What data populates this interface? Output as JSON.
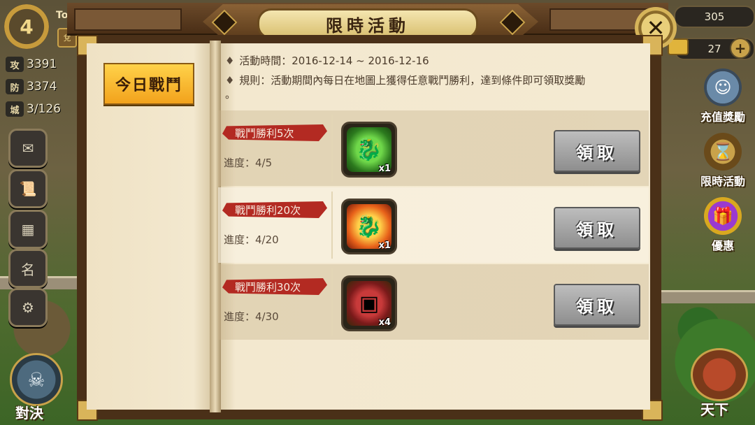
{
  "player": {
    "level": "4",
    "name": "Toto",
    "vip_label": "兌",
    "stats": [
      {
        "icon": "攻",
        "value": "3391"
      },
      {
        "icon": "防",
        "value": "3374"
      },
      {
        "icon": "城",
        "value": "3/126"
      }
    ]
  },
  "left_menu": {
    "items": [
      {
        "name": "mail",
        "glyph": "✉"
      },
      {
        "name": "scroll",
        "glyph": "📜"
      },
      {
        "name": "calendar",
        "glyph": "▦"
      },
      {
        "name": "rank",
        "glyph": "名"
      },
      {
        "name": "settings",
        "glyph": "⚙"
      }
    ],
    "duel_label": "對決"
  },
  "resources": {
    "top_value": "305",
    "gold_value": "27",
    "plus": "+"
  },
  "right_menu": {
    "recharge_label": "充值獎勵",
    "limited_label": "限時活動",
    "discount_label": "優惠",
    "tianxia_label": "天下"
  },
  "dialog": {
    "title": "限時活動",
    "close": "✕",
    "tab_label": "今日戰鬥",
    "time_line": "活動時間：2016-12-14 ~ 2016-12-16",
    "rule_line": "規則：活動期間內每日在地圖上獲得任意戰鬥勝利，達到條件即可領取獎勵",
    "rule_line_end": "。",
    "rows": [
      {
        "goal": "戰鬥勝利5次",
        "progress": "進度：4/5",
        "item_icon": "green-jade-seal-icon",
        "qty": "x1",
        "claim": "領取"
      },
      {
        "goal": "戰鬥勝利20次",
        "progress": "進度：4/20",
        "item_icon": "gold-fire-seal-icon",
        "qty": "x1",
        "claim": "領取"
      },
      {
        "goal": "戰鬥勝利30次",
        "progress": "進度：4/30",
        "item_icon": "treasure-chest-icon",
        "qty": "x4",
        "claim": "領取"
      }
    ]
  },
  "colors": {
    "ribbon": "#b32a22",
    "tab_active": "#f2a21c",
    "claim_disabled": "#9e9e9e",
    "paper": "#f4ead2"
  }
}
